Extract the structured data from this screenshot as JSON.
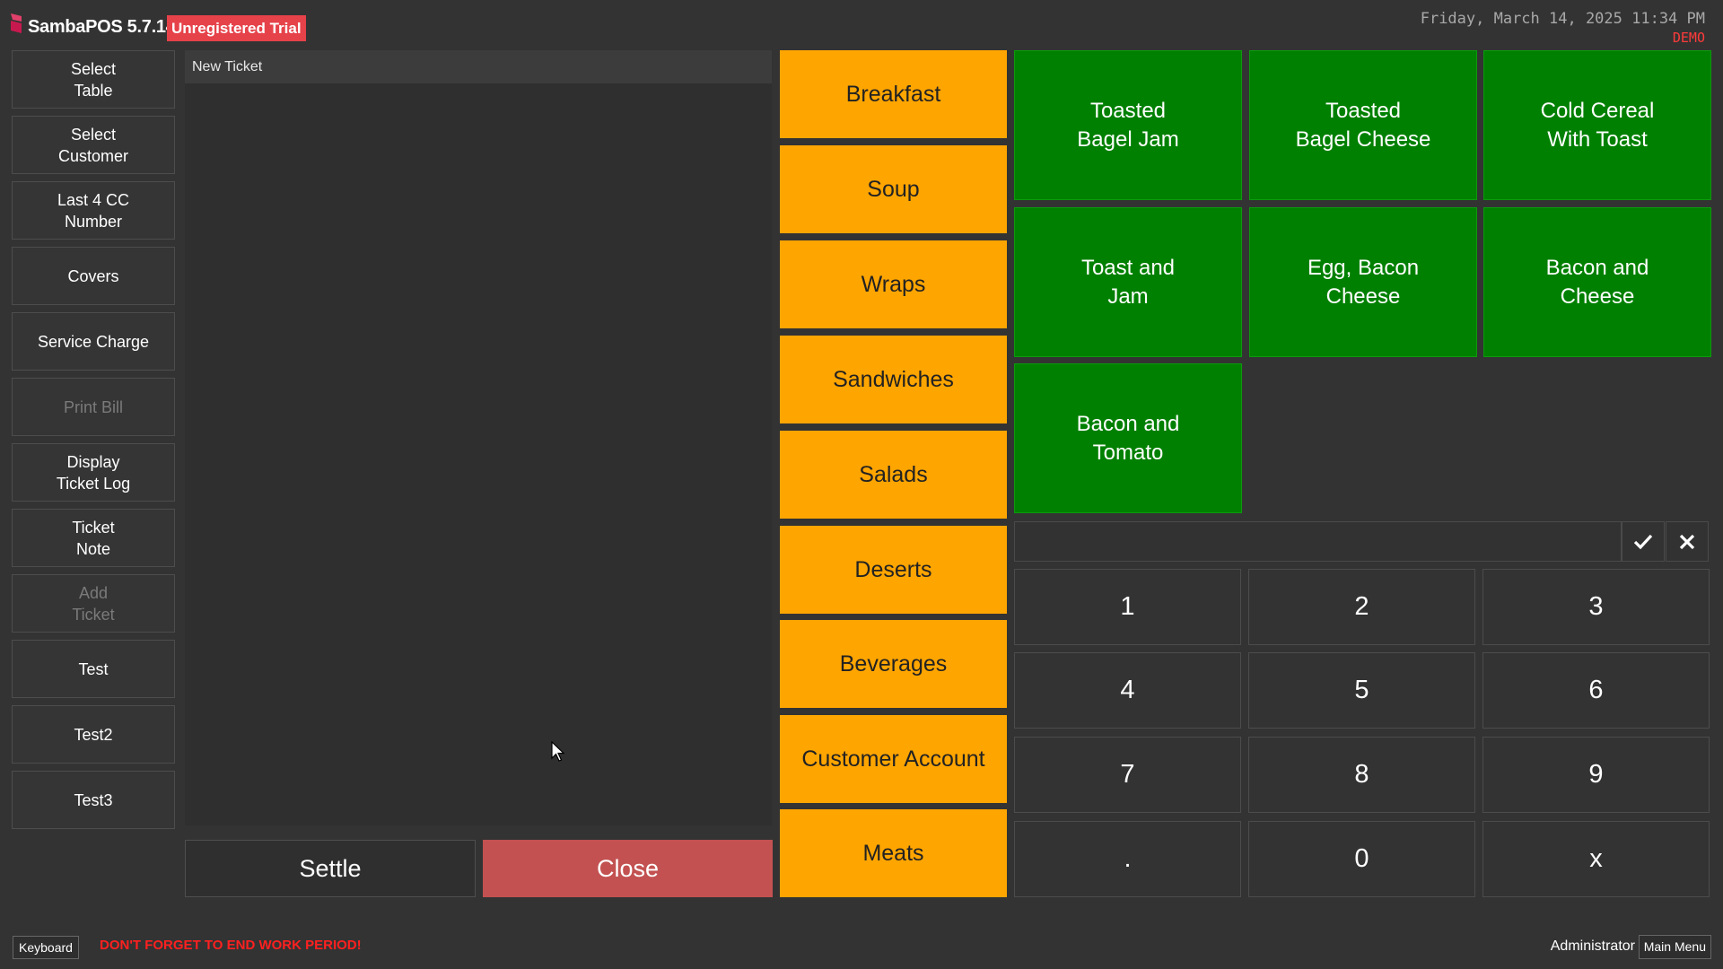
{
  "header": {
    "app_title": "SambaPOS 5.7.14",
    "trial_badge": "Unregistered Trial",
    "datetime": "Friday, March 14, 2025 11:34 PM",
    "mode": "DEMO"
  },
  "commands": [
    {
      "label": "Select\nTable",
      "enabled": true
    },
    {
      "label": "Select\nCustomer",
      "enabled": true
    },
    {
      "label": "Last 4 CC\nNumber",
      "enabled": true
    },
    {
      "label": "Covers",
      "enabled": true
    },
    {
      "label": "Service Charge",
      "enabled": true
    },
    {
      "label": "Print Bill",
      "enabled": false
    },
    {
      "label": "Display\nTicket Log",
      "enabled": true
    },
    {
      "label": "Ticket\nNote",
      "enabled": true
    },
    {
      "label": "Add\nTicket",
      "enabled": false
    },
    {
      "label": "Test",
      "enabled": true
    },
    {
      "label": "Test2",
      "enabled": true
    },
    {
      "label": "Test3",
      "enabled": true
    }
  ],
  "ticket": {
    "title": "New Ticket",
    "settle_label": "Settle",
    "close_label": "Close"
  },
  "categories": [
    "Breakfast",
    "Soup",
    "Wraps",
    "Sandwiches",
    "Salads",
    "Deserts",
    "Beverages",
    "Customer Account",
    "Meats"
  ],
  "menu_items": [
    "Toasted\nBagel Jam",
    "Toasted\nBagel Cheese",
    "Cold Cereal\nWith Toast",
    "Toast and\nJam",
    "Egg, Bacon\nCheese",
    "Bacon and\nCheese",
    "Bacon and\nTomato"
  ],
  "numpad": {
    "value": "",
    "keys": [
      "1",
      "2",
      "3",
      "4",
      "5",
      "6",
      "7",
      "8",
      "9",
      ".",
      "0",
      "x"
    ]
  },
  "footer": {
    "keyboard_label": "Keyboard",
    "warning": "DON'T FORGET TO END WORK PERIOD!",
    "user": "Administrator",
    "main_menu_label": "Main Menu"
  },
  "colors": {
    "background": "#333333",
    "category": "#ffa500",
    "menu_item": "#008000",
    "close_button": "#c35151",
    "trial_badge": "#e6424a",
    "warning": "#ff2020"
  },
  "icons": [
    "samba-logo-icon",
    "check-icon",
    "close-icon",
    "mouse-cursor-icon"
  ]
}
